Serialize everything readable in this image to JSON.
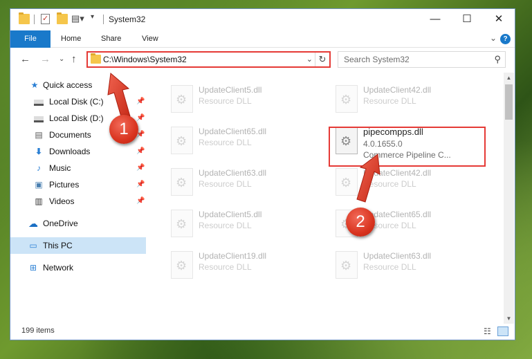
{
  "window": {
    "title": "System32",
    "controls": {
      "minimize": "—",
      "maximize": "☐",
      "close": "✕"
    }
  },
  "ribbon": {
    "tabs": [
      "File",
      "Home",
      "Share",
      "View"
    ],
    "help": "?"
  },
  "navigation": {
    "address": "C:\\Windows\\System32",
    "search_placeholder": "Search System32"
  },
  "sidebar": {
    "items": [
      {
        "label": "Quick access",
        "icon": "star-icon",
        "pinned": false
      },
      {
        "label": "Local Disk (C:)",
        "icon": "drive-icon",
        "pinned": true
      },
      {
        "label": "Local Disk (D:)",
        "icon": "drive-icon",
        "pinned": true
      },
      {
        "label": "Documents",
        "icon": "documents-icon",
        "pinned": true
      },
      {
        "label": "Downloads",
        "icon": "downloads-icon",
        "pinned": true
      },
      {
        "label": "Music",
        "icon": "music-icon",
        "pinned": true
      },
      {
        "label": "Pictures",
        "icon": "pictures-icon",
        "pinned": true
      },
      {
        "label": "Videos",
        "icon": "videos-icon",
        "pinned": true
      },
      {
        "label": "OneDrive",
        "icon": "cloud-icon",
        "pinned": false
      },
      {
        "label": "This PC",
        "icon": "computer-icon",
        "pinned": false,
        "selected": true
      },
      {
        "label": "Network",
        "icon": "network-icon",
        "pinned": false
      }
    ]
  },
  "files": [
    {
      "name": "UpdateClient5.dll",
      "type": "Resource DLL",
      "faded": true
    },
    {
      "name": "UpdateClient42.dll",
      "type": "Resource DLL",
      "faded": true
    },
    {
      "name": "UpdateClient65.dll",
      "type": "Resource DLL",
      "faded": true
    },
    {
      "name": "pipecompps.dll",
      "type": "4.0.1655.0",
      "desc": "Commerce Pipeline C...",
      "faded": false
    },
    {
      "name": "UpdateClient63.dll",
      "type": "Resource DLL",
      "faded": true
    },
    {
      "name": "UpdateClient42.dll",
      "type": "Resource DLL",
      "faded": true
    },
    {
      "name": "UpdateClient5.dll",
      "type": "Resource DLL",
      "faded": true
    },
    {
      "name": "UpdateClient65.dll",
      "type": "Resource DLL",
      "faded": true
    },
    {
      "name": "UpdateClient19.dll",
      "type": "Resource DLL",
      "faded": true
    },
    {
      "name": "UpdateClient63.dll",
      "type": "Resource DLL",
      "faded": true
    }
  ],
  "status": {
    "item_count": "199 items"
  },
  "callouts": [
    {
      "number": "1"
    },
    {
      "number": "2"
    }
  ],
  "colors": {
    "accent": "#1979ca",
    "highlight": "#e53935",
    "selected_bg": "#cce4f7"
  }
}
